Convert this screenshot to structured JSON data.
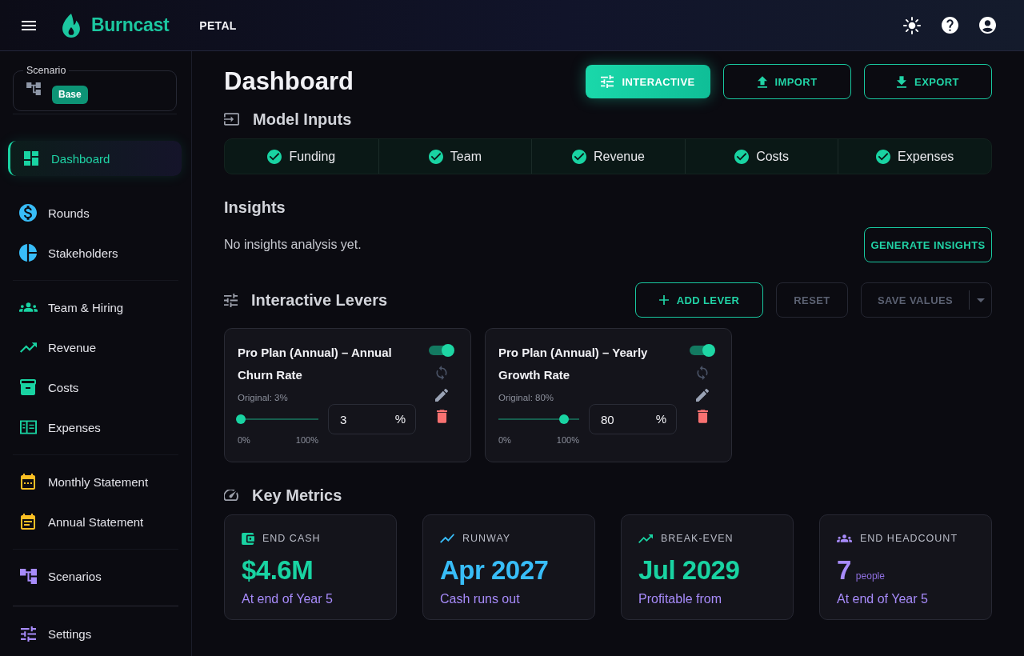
{
  "app_bar": {
    "brand": "Burncast",
    "workspace": "PETAL"
  },
  "sidebar": {
    "scenario": {
      "label": "Scenario",
      "value": "Base"
    },
    "sections": [
      {
        "items": [
          {
            "label": "Dashboard",
            "selected": true,
            "color": "#19d3a2"
          }
        ]
      },
      {
        "items": [
          {
            "label": "Rounds",
            "selected": false,
            "color": "#38bdf8"
          },
          {
            "label": "Stakeholders",
            "selected": false,
            "color": "#38bdf8"
          }
        ]
      },
      {
        "items": [
          {
            "label": "Team & Hiring",
            "selected": false,
            "color": "#19d3a2"
          },
          {
            "label": "Revenue",
            "selected": false,
            "color": "#19d3a2"
          },
          {
            "label": "Costs",
            "selected": false,
            "color": "#19d3a2"
          },
          {
            "label": "Expenses",
            "selected": false,
            "color": "#19d3a2"
          }
        ]
      },
      {
        "items": [
          {
            "label": "Monthly Statement",
            "selected": false,
            "color": "#fbbf24"
          },
          {
            "label": "Annual Statement",
            "selected": false,
            "color": "#fbbf24"
          }
        ]
      },
      {
        "items": [
          {
            "label": "Scenarios",
            "selected": false,
            "color": "#a78bfa"
          }
        ]
      },
      {
        "items": [
          {
            "label": "Settings",
            "selected": false,
            "color": "#a78bfa"
          }
        ]
      }
    ]
  },
  "page": {
    "title": "Dashboard",
    "actions": [
      {
        "label": "INTERACTIVE",
        "kind": "filled"
      },
      {
        "label": "IMPORT",
        "kind": "outlined"
      },
      {
        "label": "EXPORT",
        "kind": "outlined"
      }
    ]
  },
  "model_inputs": {
    "title": "Model Inputs",
    "steps": [
      {
        "label": "Funding",
        "complete": true
      },
      {
        "label": "Team",
        "complete": true
      },
      {
        "label": "Revenue",
        "complete": true
      },
      {
        "label": "Costs",
        "complete": true
      },
      {
        "label": "Expenses",
        "complete": true
      }
    ]
  },
  "insights": {
    "title": "Insights",
    "message": "No insights analysis yet.",
    "action": "GENERATE INSIGHTS"
  },
  "levers": {
    "title": "Interactive Levers",
    "actions": [
      {
        "label": "ADD LEVER",
        "kind": "add",
        "disabled": false
      },
      {
        "label": "RESET",
        "kind": "plain",
        "disabled": true
      },
      {
        "label": "SAVE VALUES",
        "kind": "split",
        "disabled": true
      }
    ],
    "cards": [
      {
        "name": "Pro Plan (Annual) – Annual Churn Rate",
        "enabled": true,
        "reset_disabled": true,
        "original": "Original: 3%",
        "level": 0.03,
        "min": "0%",
        "max": "100%",
        "value": "3",
        "unit": "%"
      },
      {
        "name": "Pro Plan (Annual) – Yearly Growth Rate",
        "enabled": true,
        "reset_disabled": true,
        "original": "Original: 80%",
        "level": 0.8,
        "min": "0%",
        "max": "100%",
        "value": "80",
        "unit": "%"
      }
    ]
  },
  "key_metrics": {
    "title": "Key Metrics",
    "cards": [
      {
        "label": "END CASH",
        "value": "$4.6M",
        "note": "At end of Year 5",
        "color": "#19d3a2"
      },
      {
        "label": "RUNWAY",
        "value": "Apr 2027",
        "note": "Cash runs out",
        "color": "#38bdf8"
      },
      {
        "label": "BREAK-EVEN",
        "value": "Jul 2029",
        "note": "Profitable from",
        "color": "#19d3a2"
      },
      {
        "label": "END HEADCOUNT",
        "value": "7",
        "unit": "people",
        "note": "At end of Year 5",
        "color": "#a78bfa"
      }
    ]
  }
}
